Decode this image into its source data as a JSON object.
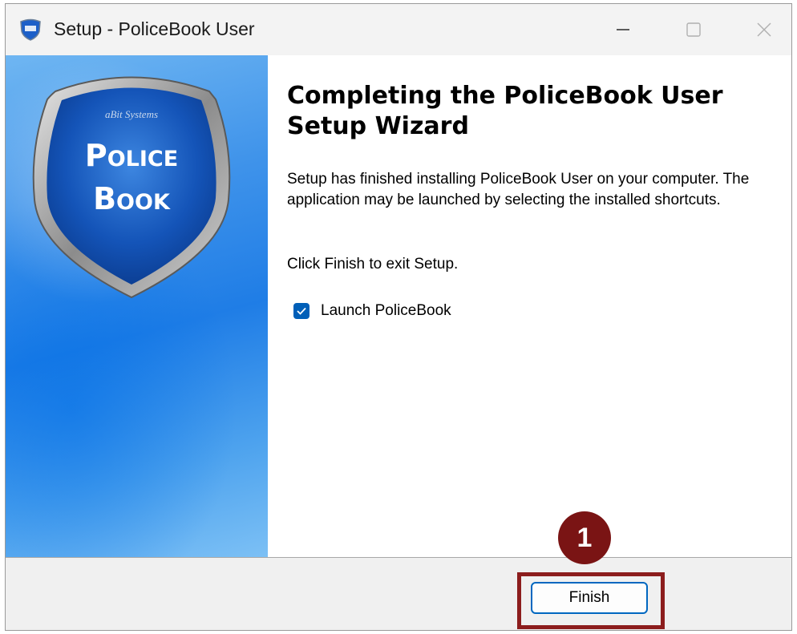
{
  "window": {
    "title": "Setup - PoliceBook User"
  },
  "side_panel": {
    "logo": {
      "top_text": "aBit Systems",
      "line1": "Police",
      "line2": "Book"
    }
  },
  "content": {
    "heading": "Completing the PoliceBook User Setup Wizard",
    "body": "Setup has finished installing PoliceBook User on your computer. The application may be launched by selecting the installed shortcuts.",
    "exit_instruction": "Click Finish to exit Setup.",
    "launch_checkbox": {
      "label": "Launch PoliceBook",
      "checked": true
    }
  },
  "footer": {
    "finish_label": "Finish"
  },
  "annotation": {
    "step_number": "1"
  },
  "colors": {
    "accent": "#005fb8",
    "highlight": "#8c1d1d",
    "badge": "#7a1414"
  }
}
